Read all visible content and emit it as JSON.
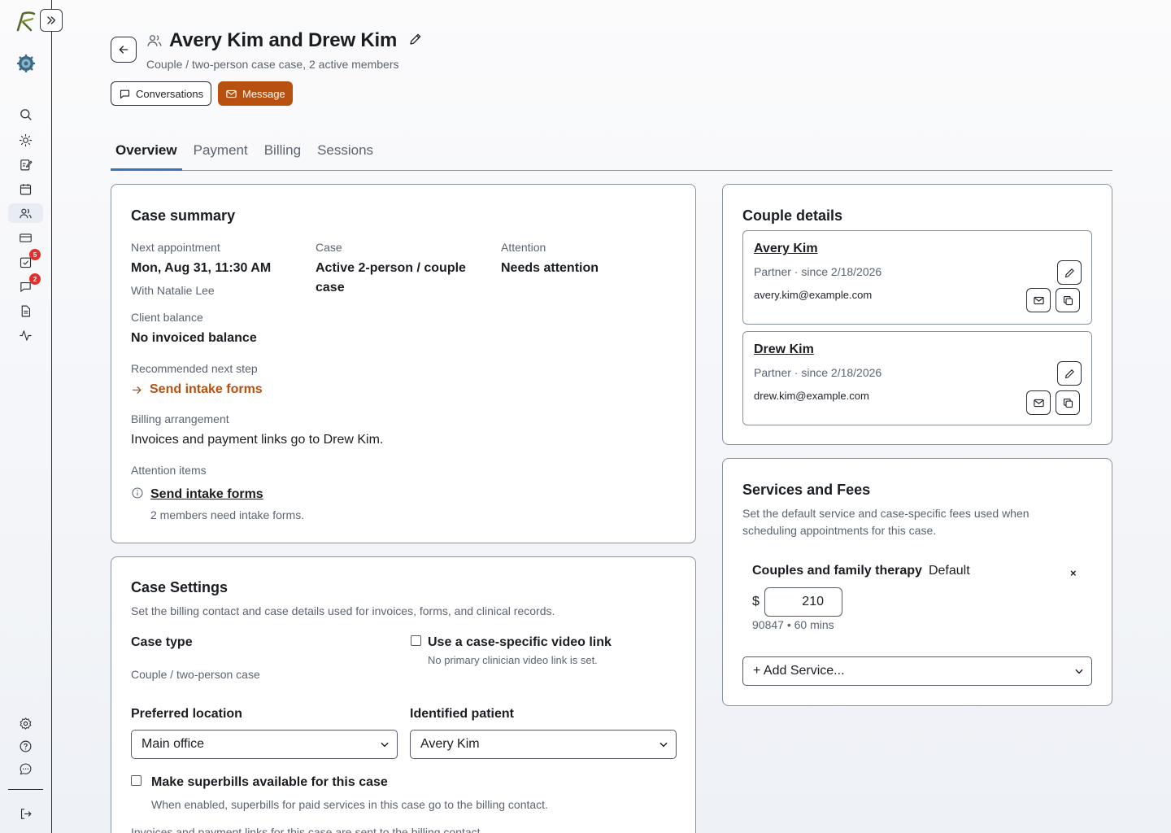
{
  "sidebar": {
    "badges": {
      "tasks": "5",
      "messages": "2"
    }
  },
  "header": {
    "title": "Avery Kim and Drew Kim",
    "subtitle": "Couple / two-person case case, 2 active members",
    "conversations_label": "Conversations",
    "message_label": "Message"
  },
  "tabs": [
    {
      "label": "Overview"
    },
    {
      "label": "Payment"
    },
    {
      "label": "Billing"
    },
    {
      "label": "Sessions"
    }
  ],
  "case_summary": {
    "title": "Case summary",
    "next_appointment_label": "Next appointment",
    "next_appointment_value": "Mon, Aug 31, 11:30 AM",
    "next_appointment_with": "With Natalie Lee",
    "case_label": "Case",
    "case_value_line1": "Active 2-person / couple",
    "case_value_line2": "case",
    "attention_label": "Attention",
    "attention_value": "Needs attention",
    "client_balance_label": "Client balance",
    "client_balance_value": "No invoiced balance",
    "recommended_label": "Recommended next step",
    "recommended_link": "Send intake forms",
    "billing_arrangement_label": "Billing arrangement",
    "billing_arrangement_value": "Invoices and payment links go to Drew Kim.",
    "attention_items_label": "Attention items",
    "attention_item_link": "Send intake forms",
    "attention_item_desc": "2 members need intake forms."
  },
  "case_settings": {
    "title": "Case Settings",
    "description": "Set the billing contact and case details used for invoices, forms, and clinical records.",
    "case_type_label": "Case type",
    "case_type_value": "Couple / two-person case",
    "video_link_label": "Use a case-specific video link",
    "video_link_desc": "No primary clinician video link is set.",
    "preferred_location_label": "Preferred location",
    "preferred_location_value": "Main office",
    "identified_patient_label": "Identified patient",
    "identified_patient_value": "Avery Kim",
    "superbills_label": "Make superbills available for this case",
    "superbills_desc": "When enabled, superbills for paid services in this case go to the billing contact.",
    "footer_partial": "Invoices and payment links for this case are sent to the billing contact."
  },
  "couple_details": {
    "title": "Couple details",
    "members": [
      {
        "name": "Avery Kim",
        "role": "Partner · since 2/18/2026",
        "email": "avery.kim@example.com"
      },
      {
        "name": "Drew Kim",
        "role": "Partner · since 2/18/2026",
        "email": "drew.kim@example.com"
      }
    ]
  },
  "services": {
    "title": "Services and Fees",
    "description_line1": "Set the default service and case-specific fees used when",
    "description_line2": "scheduling appointments for this case.",
    "service_name": "Couples and family therapy",
    "service_default": "Default",
    "remove_symbol": "×",
    "currency": "$",
    "fee": "210",
    "service_meta": "90847 • 60 mins",
    "add_service_label": "+ Add Service..."
  },
  "colors": {
    "accent": "#b8510f",
    "tab_indicator": "#3d73b8",
    "badge": "#e03131"
  }
}
